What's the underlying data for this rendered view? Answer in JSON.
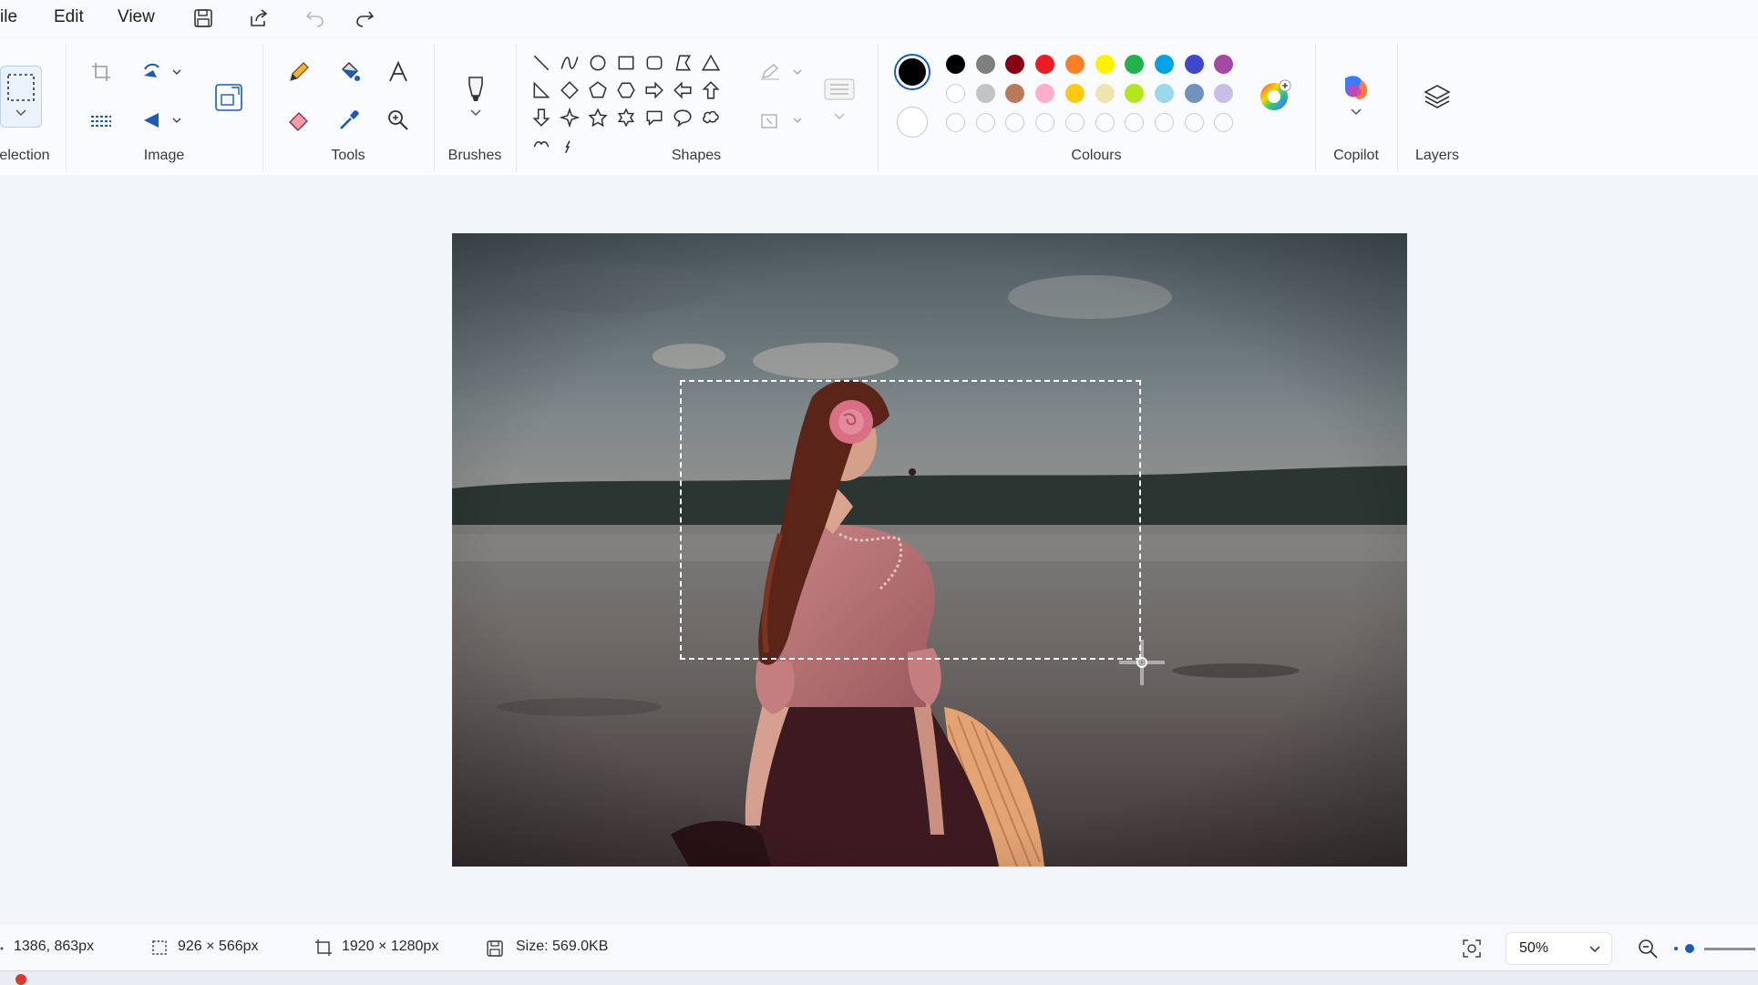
{
  "menu": {
    "file": "ile",
    "edit": "Edit",
    "view": "View"
  },
  "quick_access": {
    "icons": [
      "save-icon",
      "share-icon",
      "undo-icon",
      "redo-icon"
    ]
  },
  "ribbon": {
    "groups": {
      "selection": "election",
      "image": "Image",
      "tools": "Tools",
      "brushes": "Brushes",
      "shapes": "Shapes",
      "colours": "Colours",
      "copilot": "Copilot",
      "layers": "Layers"
    },
    "image_tools": [
      "crop-icon",
      "rotate-icon",
      "resize-icon",
      "image-recolor-icon",
      "flip-icon"
    ],
    "tools": [
      "pencil-icon",
      "fill-icon",
      "text-icon",
      "eraser-icon",
      "color-picker-icon",
      "magnifier-icon"
    ],
    "shapes": [
      "line",
      "curve",
      "oval",
      "rectangle",
      "rounded-rectangle",
      "polygon",
      "triangle",
      "right-triangle",
      "diamond",
      "pentagon",
      "hexagon",
      "right-arrow",
      "left-arrow",
      "up-arrow",
      "down-arrow",
      "four-point-star",
      "five-point-star",
      "six-point-star",
      "rounded-callout",
      "oval-callout",
      "cloud-callout",
      "heart",
      "lightning"
    ],
    "colours": {
      "primary": "#000000",
      "secondary": "#ffffff",
      "row1": [
        "#000000",
        "#7f7f7f",
        "#880015",
        "#ed1c24",
        "#ff7f27",
        "#fff200",
        "#22b14c",
        "#00a2e8",
        "#3f48cc",
        "#a349a4"
      ],
      "row2": [
        "#ffffff",
        "#c3c3c3",
        "#b97a57",
        "#ffaec9",
        "#ffc90e",
        "#efe4b0",
        "#b5e61d",
        "#99d9ea",
        "#7092be",
        "#c8bfe7"
      ],
      "row3_empty_count": 10
    }
  },
  "status": {
    "cursor": "1386, 863px",
    "selection_size": "926 × 566px",
    "canvas_size": "1920 × 1280px",
    "file_size": "Size: 569.0KB",
    "zoom": "50%"
  }
}
